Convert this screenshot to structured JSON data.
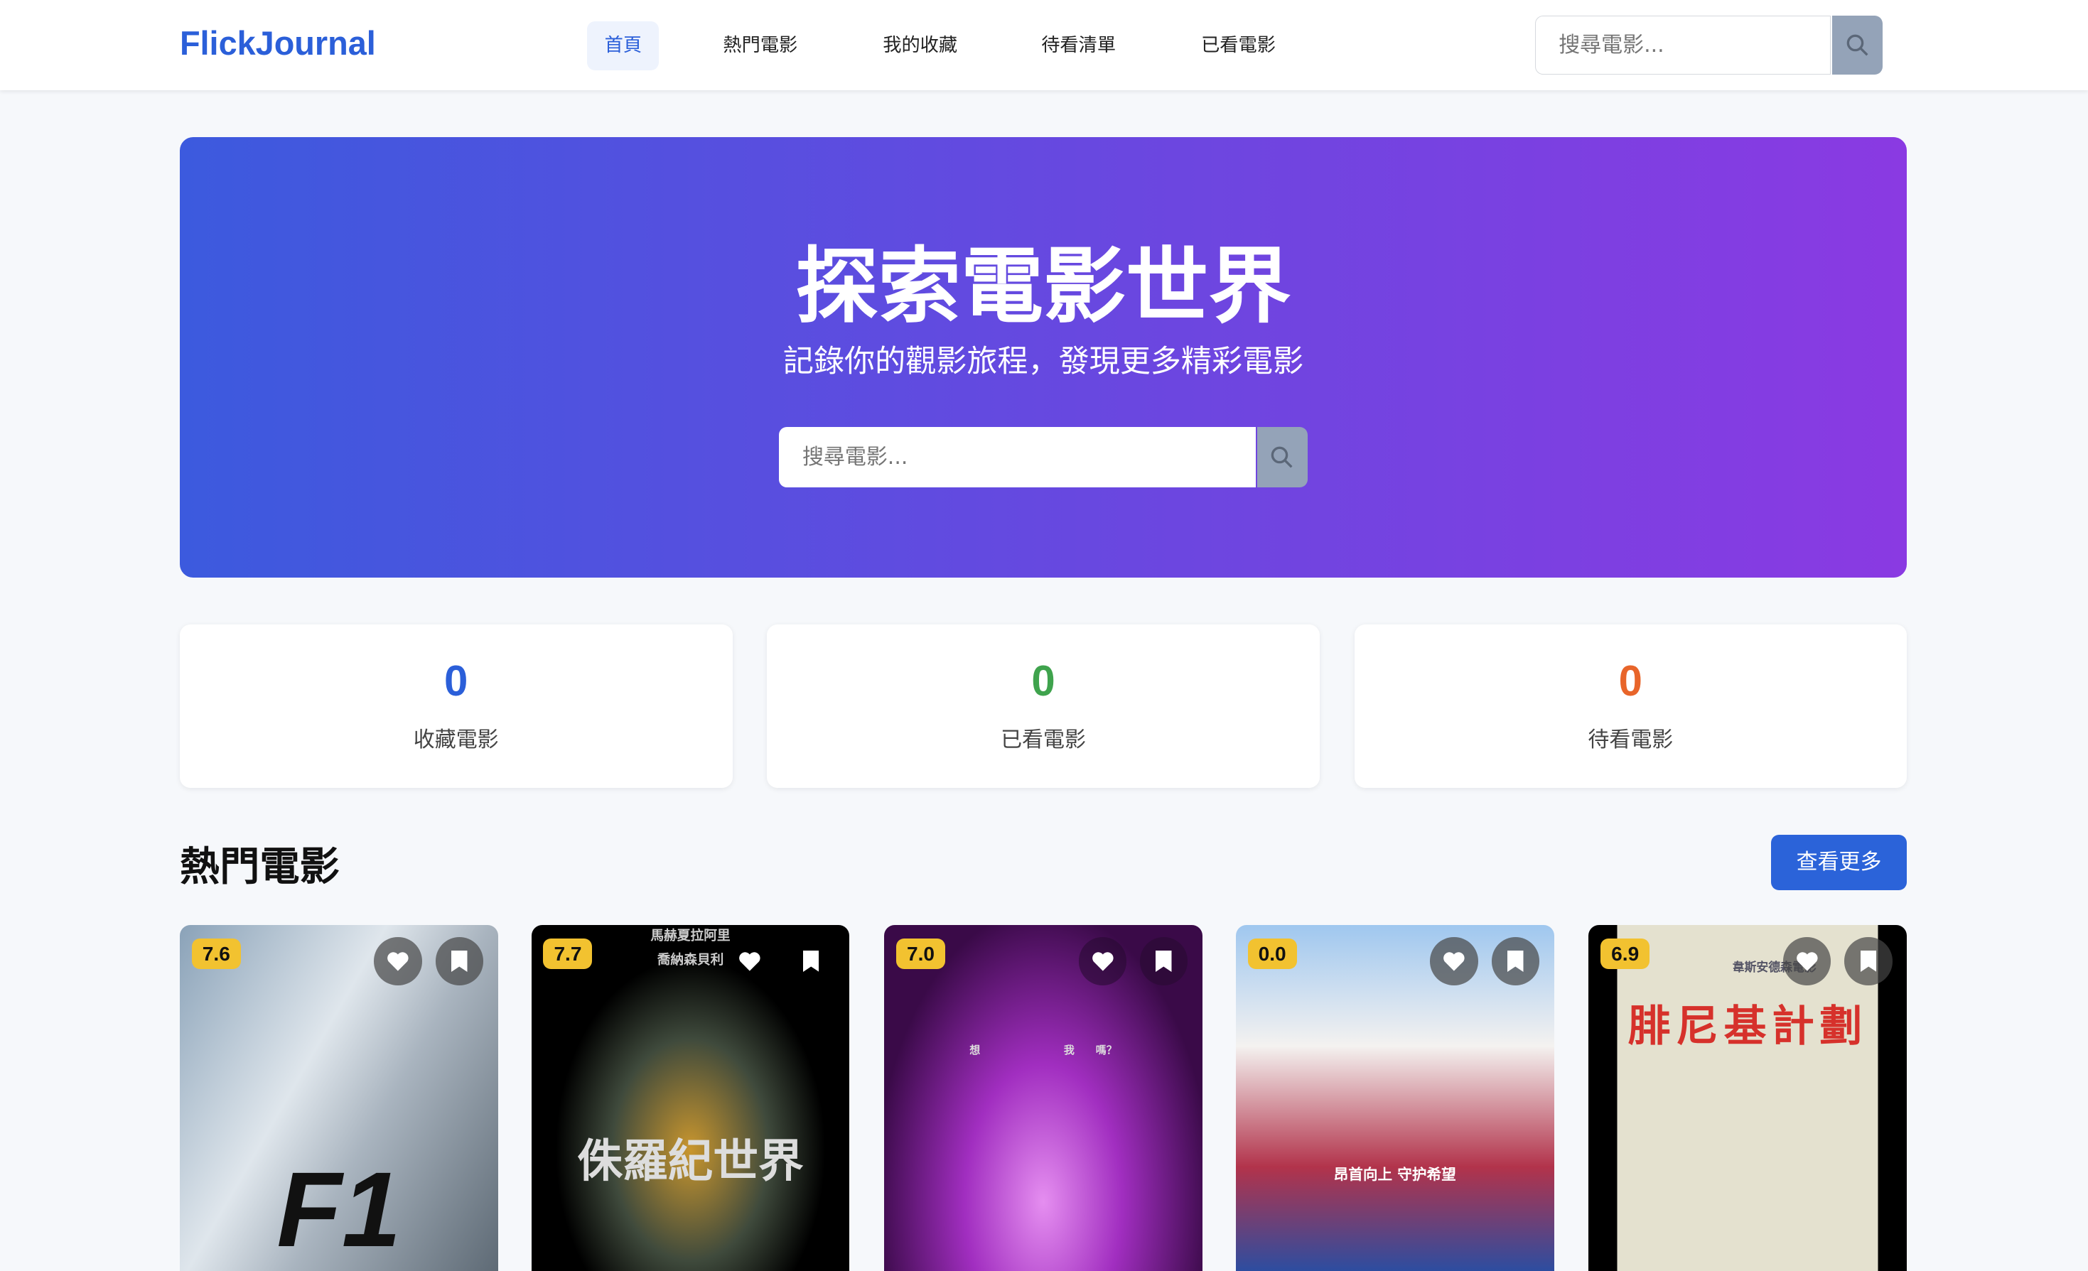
{
  "header": {
    "logo": "FlickJournal",
    "nav": [
      {
        "label": "首頁",
        "active": true
      },
      {
        "label": "熱門電影"
      },
      {
        "label": "我的收藏"
      },
      {
        "label": "待看清單"
      },
      {
        "label": "已看電影"
      }
    ],
    "search_placeholder": "搜尋電影..."
  },
  "hero": {
    "title": "探索電影世界",
    "subtitle": "記錄你的觀影旅程，發現更多精彩電影",
    "search_placeholder": "搜尋電影..."
  },
  "stats": [
    {
      "value": "0",
      "label": "收藏電影",
      "color": "#2b5fd9"
    },
    {
      "value": "0",
      "label": "已看電影",
      "color": "#3fa34d"
    },
    {
      "value": "0",
      "label": "待看電影",
      "color": "#e8652a"
    }
  ],
  "popular": {
    "title": "熱門電影",
    "more_label": "查看更多",
    "movies": [
      {
        "rating": "7.6",
        "poster_text": "F1"
      },
      {
        "rating": "7.7",
        "poster_text": "侏羅紀世界",
        "poster_top": "馬赫夏拉阿里",
        "poster_top2": "喬納森貝利"
      },
      {
        "rating": "7.0",
        "poster_text": "想 我　　嗎？"
      },
      {
        "rating": "0.0",
        "poster_text": "昂首向上 守护希望"
      },
      {
        "rating": "6.9",
        "poster_text": "腓尼基計劃",
        "poster_top": "韋斯安德森電影"
      }
    ]
  }
}
